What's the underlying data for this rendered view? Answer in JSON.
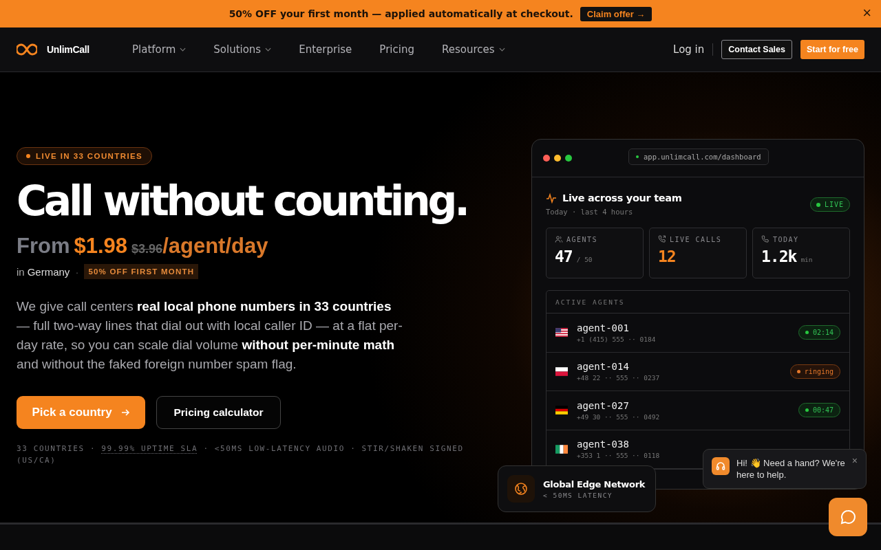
{
  "promo_banner": {
    "text": "50% OFF your first month — applied automatically at checkout.",
    "button": "Claim offer →",
    "close": "×"
  },
  "nav": {
    "brand": "UnlimCall",
    "items": [
      {
        "label": "Platform",
        "has_menu": true
      },
      {
        "label": "Solutions",
        "has_menu": true
      },
      {
        "label": "Enterprise",
        "has_menu": false
      },
      {
        "label": "Pricing",
        "has_menu": false
      },
      {
        "label": "Resources",
        "has_menu": true
      }
    ],
    "login": "Log in",
    "contact": "Contact Sales",
    "start": "Start for free"
  },
  "hero": {
    "badge": "LIVE IN 33 COUNTRIES",
    "title": "Call without counting.",
    "price": {
      "from": "From",
      "amount": "$1.98",
      "old": "$3.96",
      "unit": "/agent/day"
    },
    "location_prefix": "in",
    "location": "Germany",
    "separator": "·",
    "offer_tag": "50% OFF FIRST MONTH",
    "description": "We give call centers **real local phone numbers in 33 countries** — full two-way lines that dial out with local caller ID — at a flat per-day rate, so you can scale dial volume **without per-minute math** and without the faked foreign number spam flag.",
    "primary_button": "Pick a country",
    "secondary_button": "Pricing calculator",
    "stats": {
      "before": "33 COUNTRIES ·",
      "link": "99.99% UPTIME SLA",
      "after": "· <50MS LOW-LATENCY AUDIO · STIR/SHAKEN SIGNED (US/CA)"
    }
  },
  "dashboard": {
    "url": "app.unlimcall.com/dashboard",
    "title": "Live across your team",
    "subtitle": "Today · last 4 hours",
    "live_badge": "LIVE",
    "stats": [
      {
        "label": "AGENTS",
        "value": "47",
        "unit": "/ 50",
        "highlight": false
      },
      {
        "label": "LIVE CALLS",
        "value": "12",
        "highlight": true
      },
      {
        "label": "TODAY",
        "value": "1.2k",
        "unit": "min",
        "highlight": false
      }
    ],
    "agents_heading": "ACTIVE AGENTS",
    "agents": [
      {
        "name": "agent-001",
        "phone": "+1 (415) 555 ·· 0184",
        "status": {
          "kind": "timer",
          "text": "02:14"
        }
      },
      {
        "name": "agent-014",
        "phone": "+48 22 ·· 555 ·· 0237",
        "status": {
          "kind": "ringing",
          "text": "ringing"
        }
      },
      {
        "name": "agent-027",
        "phone": "+49 30 ·· 555 ·· 0492",
        "status": {
          "kind": "timer",
          "text": "00:47"
        }
      },
      {
        "name": "agent-038",
        "phone": "+353 1 ·· 555 ·· 0118"
      }
    ]
  },
  "edge_card": {
    "title": "Global Edge Network",
    "subtitle": "< 50MS LATENCY"
  },
  "chat_popup": {
    "text": "Hi! 👋 Need a hand? We're here to help.",
    "close": "×"
  }
}
